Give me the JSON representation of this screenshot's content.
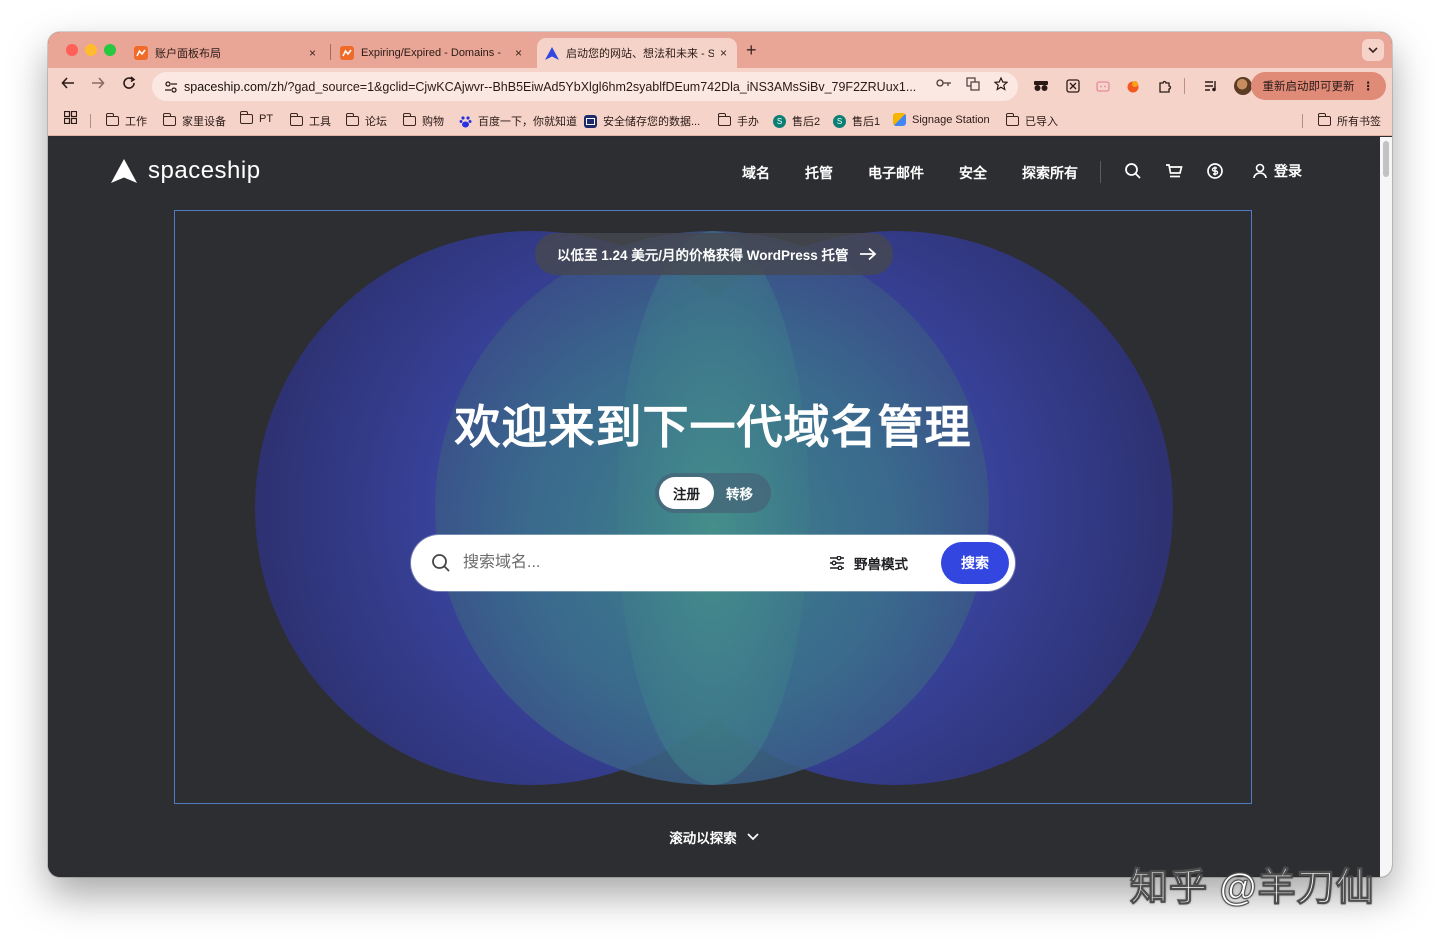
{
  "browser": {
    "tabs": [
      {
        "title": "账户面板布局",
        "close": "×"
      },
      {
        "title": "Expiring/Expired - Domains -",
        "close": "×"
      },
      {
        "title": "启动您的网站、想法和未来 - S",
        "close": "×",
        "active": true
      }
    ],
    "new_tab": "+",
    "url_host": "spaceship.com",
    "url_rest": "/zh/?gad_source=1&gclid=CjwKCAjwvr--BhB5EiwAd5YbXlgl6hm2syablfDEum742Dla_iNS3AMsSiBv_79F2ZRUux1...",
    "relaunch_label": "重新启动即可更新",
    "bookmarks": [
      {
        "label": "工作",
        "type": "folder"
      },
      {
        "label": "家里设备",
        "type": "folder"
      },
      {
        "label": "PT",
        "type": "folder"
      },
      {
        "label": "工具",
        "type": "folder"
      },
      {
        "label": "论坛",
        "type": "folder"
      },
      {
        "label": "购物",
        "type": "folder"
      },
      {
        "label": "百度一下，你就知道",
        "type": "link",
        "icon": "baidu-icon"
      },
      {
        "label": "安全储存您的数据...",
        "type": "link",
        "icon": "storage-icon"
      },
      {
        "label": "手办",
        "type": "folder"
      },
      {
        "label": "售后2",
        "type": "link",
        "icon": "sharepoint-icon"
      },
      {
        "label": "售后1",
        "type": "link",
        "icon": "sharepoint-icon"
      },
      {
        "label": "Signage Station",
        "type": "link",
        "icon": "signage-icon"
      },
      {
        "label": "已导入",
        "type": "folder"
      }
    ],
    "all_bookmarks": "所有书签"
  },
  "site": {
    "logo_text": "spaceship",
    "nav": [
      "域名",
      "托管",
      "电子邮件",
      "安全",
      "探索所有"
    ],
    "login": "登录",
    "promo": "以低至 1.24 美元/月的价格获得 WordPress 托管",
    "headline": "欢迎来到下一代域名管理",
    "toggle": {
      "register": "注册",
      "transfer": "转移"
    },
    "search": {
      "placeholder": "搜索域名...",
      "beast_mode": "野兽模式",
      "button": "搜索"
    },
    "scroll_hint": "滚动以探索"
  },
  "watermark": "知乎 @羊刀仙",
  "colors": {
    "tab_strip": "#e9a595",
    "toolbar": "#f6d3c9",
    "page_bg": "#2d2e31",
    "accent_blue": "#3346e0",
    "hero_border": "#5379c2"
  }
}
